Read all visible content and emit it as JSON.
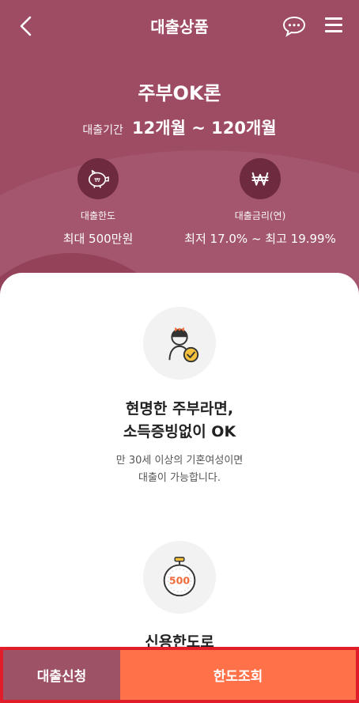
{
  "header": {
    "title": "대출상품",
    "back_icon": "chevron-left-icon",
    "chat_icon": "chat-bubble-icon",
    "menu_icon": "hamburger-menu-icon"
  },
  "product": {
    "name": "주부OK론",
    "period_label": "대출기간",
    "period_value": "12개월 ~ 120개월",
    "limit_label": "대출한도",
    "limit_value": "최대 500만원",
    "limit_icon": "piggy-bank-icon",
    "rate_label": "대출금리(연)",
    "rate_value": "최저 17.0% ~ 최고 19.99%",
    "rate_icon": "won-sign-icon"
  },
  "features": [
    {
      "icon": "woman-check-icon",
      "title_line1": "현명한 주부라면,",
      "title_line2": "소득증빙없이 OK",
      "desc_line1": "만 30세 이상의 기혼여성이면",
      "desc_line2": "대출이 가능합니다."
    },
    {
      "icon": "stopwatch-500-icon",
      "badge": "500",
      "title_line1": "신용한도로"
    }
  ],
  "bottom_bar": {
    "apply_label": "대출신청",
    "limit_check_label": "한도조회"
  },
  "colors": {
    "hero_bg": "#9e4c64",
    "icon_circle": "#6e2a3e",
    "apply_bg": "#9e5266",
    "limit_bg": "#ff7149",
    "highlight_border": "#e21d2a"
  }
}
